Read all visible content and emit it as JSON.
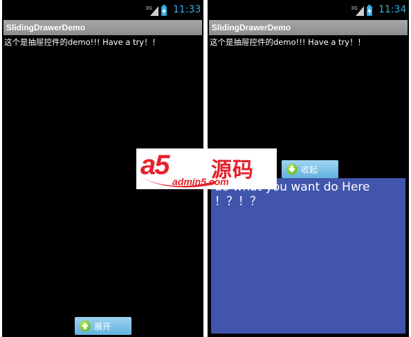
{
  "left_screen": {
    "status": {
      "network": "3G",
      "time": "11:33"
    },
    "app_title": "SlidingDrawerDemo",
    "body_text": "这个是抽屉控件的demo!!! Have a try！！",
    "drawer_handle": {
      "label": "展开",
      "icon": "arrow-up-icon"
    }
  },
  "right_screen": {
    "status": {
      "network": "3G",
      "time": "11:34"
    },
    "app_title": "SlidingDrawerDemo",
    "body_text": "这个是抽屉控件的demo!!! Have a try！！",
    "drawer_handle": {
      "label": "收起",
      "icon": "arrow-down-icon"
    },
    "drawer_content": {
      "line1": "do what you want do Here",
      "line2": "！？！？"
    }
  },
  "watermark": {
    "logo": "a5",
    "chinese": "源码",
    "url": "admin5.com"
  },
  "colors": {
    "status_time": "#33b5e5",
    "title_bar": "#9a9a9a",
    "handle_button": "#7cc3e8",
    "drawer_background": "#4255ad",
    "watermark_red": "#e8202a"
  }
}
